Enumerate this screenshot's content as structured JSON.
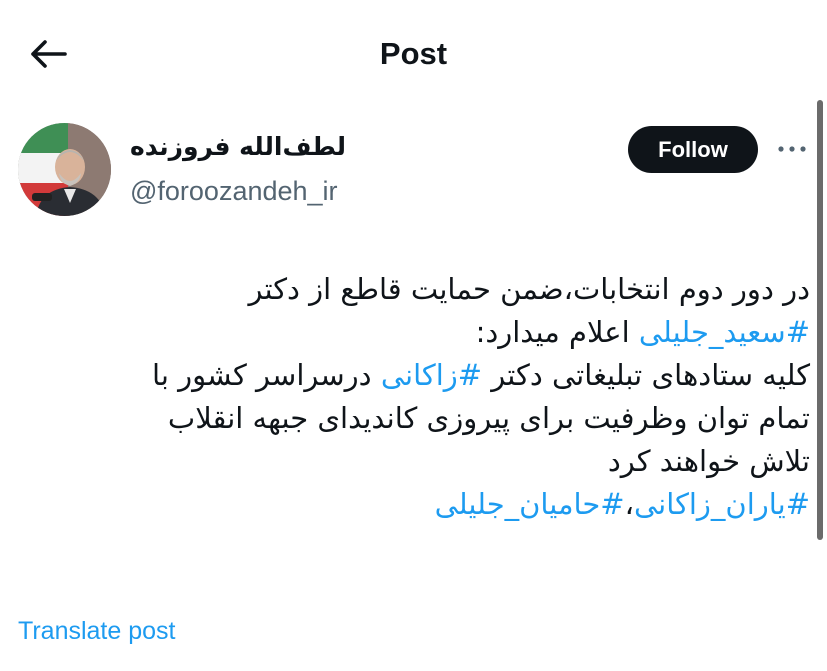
{
  "header": {
    "back_icon": "arrow-left-icon",
    "title": "Post"
  },
  "author": {
    "display_name": "لطف‌الله فروزنده",
    "handle": "@foroozandeh_ir",
    "avatar_icon": "profile-photo"
  },
  "actions": {
    "follow_label": "Follow",
    "more_icon": "ellipsis-icon"
  },
  "tweet": {
    "line1": "در دور دوم انتخابات،ضمن حمایت قاطع از دکتر",
    "line2_hashtag": "#سعید_جلیلی",
    "line2_text": " اعلام میدارد:",
    "line3_text_a": "کلیه ستادهای تبلیغاتی دکتر ",
    "line3_hashtag": "#زاکانی",
    "line3_text_b": " درسراسر کشور با",
    "line4": "تمام توان وظرفیت برای پیروزی کاندیدای جبهه انقلاب",
    "line5": "تلاش خواهند کرد",
    "line6_hashtag_a": "#یاران_زاکانی",
    "line6_sep": "،",
    "line6_hashtag_b": "#حامیان_جلیلی"
  },
  "footer": {
    "translate_label": "Translate post"
  },
  "colors": {
    "accent": "#1d9bf0",
    "text": "#0f1419",
    "muted": "#536471",
    "follow_bg": "#0f1419"
  }
}
